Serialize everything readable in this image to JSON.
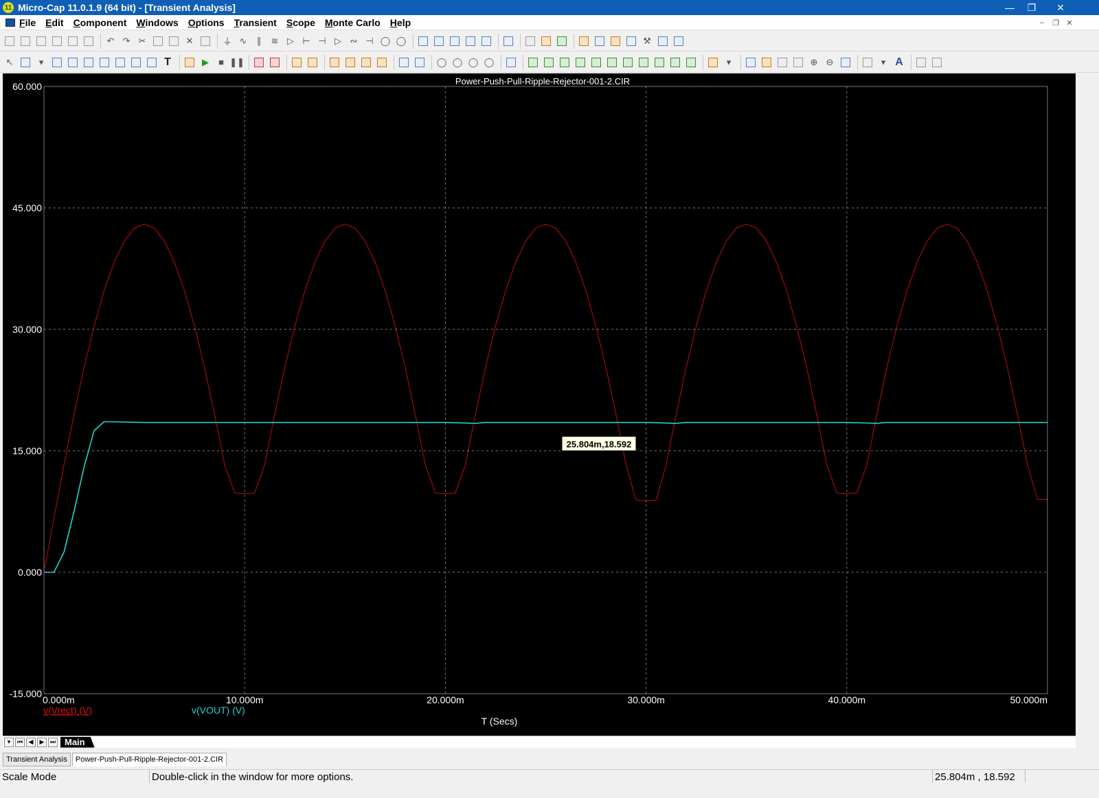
{
  "window": {
    "title": "Micro-Cap 11.0.1.9 (64 bit) - [Transient Analysis]",
    "app_icon_label": "11",
    "controls": [
      "minimize-icon",
      "restore-icon",
      "close-icon"
    ]
  },
  "menubar": {
    "items": [
      "File",
      "Edit",
      "Component",
      "Windows",
      "Options",
      "Transient",
      "Scope",
      "Monte Carlo",
      "Help"
    ]
  },
  "plot": {
    "colors": {
      "background": "#000000",
      "grid": "#7a7a7a",
      "axis_text": "#ffffff",
      "vrect": "#e01010",
      "vout": "#22d3d3"
    },
    "tooltip": "25.804m,18.592"
  },
  "chart_data": {
    "type": "line",
    "title": "Power-Push-Pull-Ripple-Rejector-001-2.CIR",
    "xlabel": "T (Secs)",
    "ylabel": "",
    "xlim": [
      0,
      0.05
    ],
    "ylim": [
      -15,
      60
    ],
    "xticks": [
      0,
      0.01,
      0.02,
      0.03,
      0.04,
      0.05
    ],
    "xtick_labels": [
      "0.000m",
      "10.000m",
      "20.000m",
      "30.000m",
      "40.000m",
      "50.000m"
    ],
    "yticks": [
      60,
      45,
      30,
      15,
      0,
      -15
    ],
    "ytick_labels": [
      "60.000",
      "45.000",
      "30.000",
      "15.000",
      "0.000",
      "-15.000"
    ],
    "grid": true,
    "series": [
      {
        "name": "v(Vrect) (V)",
        "color": "#e01010",
        "x": [
          0,
          0.0005,
          0.001,
          0.0015,
          0.002,
          0.0025,
          0.003,
          0.0035,
          0.004,
          0.0045,
          0.005,
          0.0055,
          0.006,
          0.0065,
          0.007,
          0.0075,
          0.008,
          0.0085,
          0.009,
          0.0095,
          0.01,
          0.0105,
          0.011,
          0.0115,
          0.012,
          0.0125,
          0.013,
          0.0135,
          0.014,
          0.0145,
          0.015,
          0.0155,
          0.016,
          0.0165,
          0.017,
          0.0175,
          0.018,
          0.0185,
          0.019,
          0.0195,
          0.02,
          0.0205,
          0.021,
          0.0215,
          0.022,
          0.0225,
          0.023,
          0.0235,
          0.024,
          0.0245,
          0.025,
          0.0255,
          0.026,
          0.0265,
          0.027,
          0.0275,
          0.028,
          0.0285,
          0.029,
          0.0295,
          0.03,
          0.0305,
          0.031,
          0.0315,
          0.032,
          0.0325,
          0.033,
          0.0335,
          0.034,
          0.0345,
          0.035,
          0.0355,
          0.036,
          0.0365,
          0.037,
          0.0375,
          0.038,
          0.0385,
          0.039,
          0.0395,
          0.04,
          0.0405,
          0.041,
          0.0415,
          0.042,
          0.0425,
          0.043,
          0.0435,
          0.044,
          0.0445,
          0.045,
          0.0455,
          0.046,
          0.0465,
          0.047,
          0.0475,
          0.048,
          0.0485,
          0.049,
          0.0495,
          0.05
        ],
        "y": [
          0,
          6.7,
          13.3,
          19.5,
          25.3,
          30.4,
          34.8,
          38.3,
          40.9,
          42.5,
          43,
          42.5,
          40.9,
          38.3,
          34.8,
          30.4,
          25.3,
          19.5,
          13.3,
          9.8,
          9.7,
          9.8,
          13.3,
          19.5,
          25.3,
          30.4,
          34.8,
          38.3,
          40.9,
          42.5,
          43,
          42.5,
          40.9,
          38.3,
          34.8,
          30.4,
          25.3,
          19.5,
          13.3,
          9.8,
          9.7,
          9.8,
          13.3,
          19.5,
          25.3,
          30.4,
          34.8,
          38.3,
          40.9,
          42.5,
          43,
          42.5,
          40.9,
          38.3,
          34.8,
          30.4,
          25.3,
          19.5,
          13.3,
          8.9,
          8.8,
          8.9,
          13.3,
          19.5,
          25.3,
          30.4,
          34.8,
          38.3,
          40.9,
          42.5,
          43,
          42.5,
          40.9,
          38.3,
          34.8,
          30.4,
          25.3,
          19.5,
          13.3,
          9.8,
          9.7,
          9.8,
          13.3,
          19.5,
          25.3,
          30.4,
          34.8,
          38.3,
          40.9,
          42.5,
          43,
          42.5,
          40.9,
          38.3,
          34.8,
          30.4,
          25.3,
          19.5,
          13.3,
          9.0,
          9.0
        ]
      },
      {
        "name": "v(VOUT) (V)",
        "color": "#22d3d3",
        "x": [
          0,
          0.0005,
          0.001,
          0.0015,
          0.002,
          0.0025,
          0.003,
          0.005,
          0.01,
          0.015,
          0.02,
          0.0215,
          0.022,
          0.025,
          0.03,
          0.0315,
          0.032,
          0.035,
          0.04,
          0.0415,
          0.042,
          0.045,
          0.05
        ],
        "y": [
          0,
          0,
          2.5,
          7.5,
          13,
          17.5,
          18.6,
          18.5,
          18.5,
          18.5,
          18.5,
          18.4,
          18.5,
          18.5,
          18.5,
          18.4,
          18.5,
          18.5,
          18.5,
          18.4,
          18.5,
          18.5,
          18.5
        ]
      }
    ],
    "cursor": {
      "x": 0.025804,
      "y": 18.592
    }
  },
  "sheet_tabs": {
    "active": "Main"
  },
  "doc_tabs": [
    "Transient Analysis",
    "Power-Push-Pull-Ripple-Rejector-001-2.CIR"
  ],
  "statusbar": {
    "mode": "Scale Mode",
    "hint": "Double-click in the window for more options.",
    "coords": "25.804m , 18.592"
  }
}
